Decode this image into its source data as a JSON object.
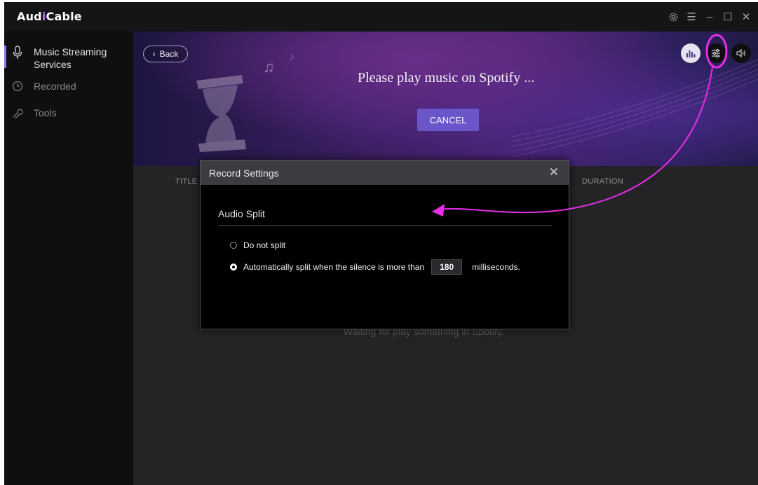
{
  "app": {
    "logo_text_a": "Aud",
    "logo_text_b": "i",
    "logo_text_c": "Cable",
    "accent_color": "#9a72ff"
  },
  "window_controls": {
    "settings": "gear-icon",
    "menu": "☰",
    "minimize": "–",
    "maximize": "☐",
    "close": "✕"
  },
  "sidebar": {
    "items": [
      {
        "label_line1": "Music Streaming",
        "label_line2": "Services",
        "icon": "microphone-icon",
        "active": true
      },
      {
        "label": "Recorded",
        "icon": "clock-icon"
      },
      {
        "label": "Tools",
        "icon": "wrench-icon"
      }
    ]
  },
  "banner": {
    "back_label": "Back",
    "message": "Please play music on Spotify ...",
    "cancel_label": "CANCEL"
  },
  "table": {
    "col_title": "TITLE",
    "col_duration": "DURATION",
    "waiting_text": "Waiting for play something in Spotify."
  },
  "dialog": {
    "title": "Record Settings",
    "close": "✕",
    "section": "Audio Split",
    "option1": "Do not split",
    "option2_prefix": "Automatically split when the silence is more than",
    "silence_ms": "180",
    "option2_suffix": "milliseconds.",
    "selected_option": "option2"
  },
  "annotation_color": "#e62ee6"
}
